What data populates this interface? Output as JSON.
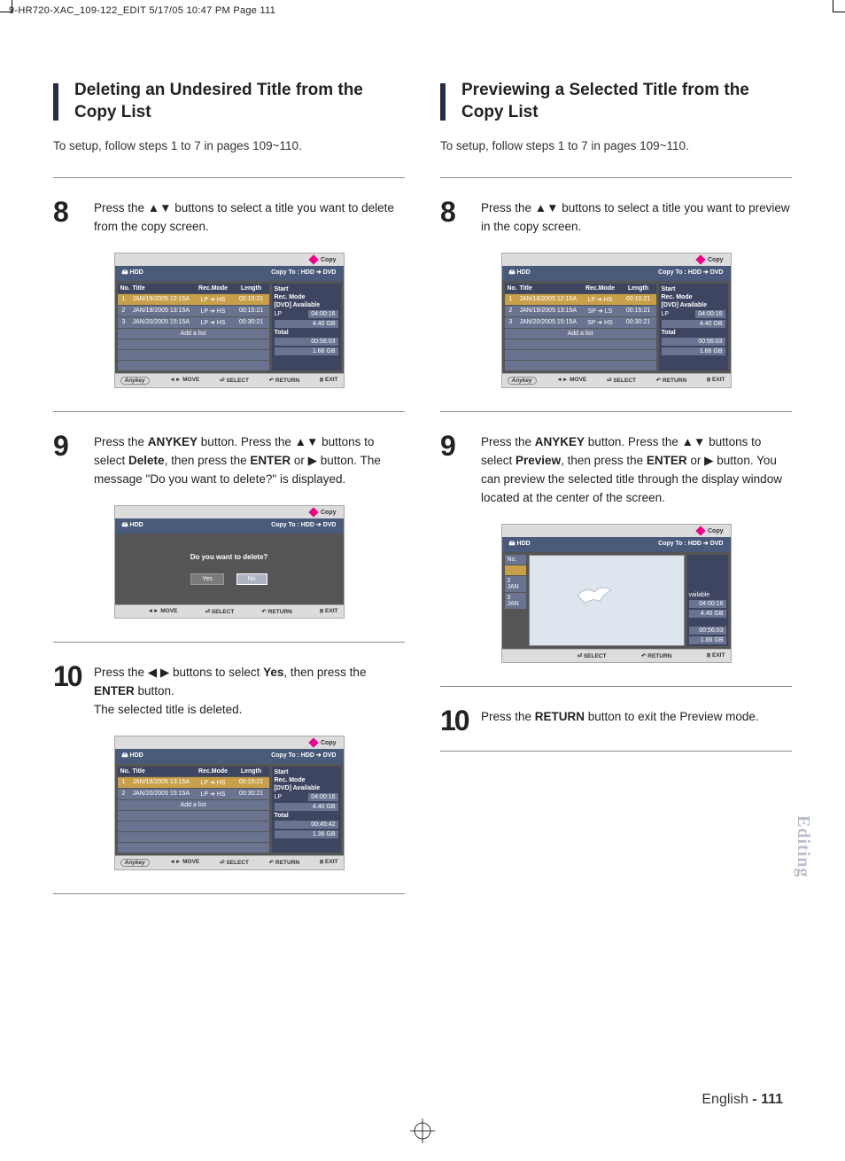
{
  "meta_header": "9-HR720-XAC_109-122_EDIT  5/17/05  10:47 PM  Page 111",
  "left": {
    "title": "Deleting an Undesired Title from the Copy List",
    "setup": "To setup, follow steps 1 to 7 in pages 109~110.",
    "step8_num": "8",
    "step8_txt": "Press the ▲▼ buttons to select a title you want to delete from the copy screen.",
    "step9_num": "9",
    "step9_txt_a": "Press the ",
    "step9_b1": "ANYKEY",
    "step9_txt_b": " button. Press the ▲▼ buttons to select ",
    "step9_b2": "Delete",
    "step9_txt_c": ", then press the ",
    "step9_b3": "ENTER",
    "step9_txt_d": " or ▶ button. The message \"Do you want to delete?\" is displayed.",
    "step10_num": "10",
    "step10_txt_a": "Press the ◀ ▶ buttons to select ",
    "step10_b1": "Yes",
    "step10_txt_b": ", then press the ",
    "step10_b2": "ENTER",
    "step10_txt_c": " button.",
    "step10_txt_d": "The selected title is deleted."
  },
  "right": {
    "title": "Previewing a Selected Title from the Copy List",
    "setup": "To setup, follow steps 1 to 7 in pages 109~110.",
    "step8_num": "8",
    "step8_txt": "Press the ▲▼ buttons to select a title you want to preview in the copy screen.",
    "step9_num": "9",
    "step9_txt_a": "Press the ",
    "step9_b1": "ANYKEY",
    "step9_txt_b": " button. Press the ▲▼ buttons to select ",
    "step9_b2": "Preview",
    "step9_txt_c": ", then press the ",
    "step9_b3": "ENTER",
    "step9_txt_d": " or ▶ button. You can preview the selected title through the display window located at the center of the screen.",
    "step10_num": "10",
    "step10_txt_a": "Press the ",
    "step10_b1": "RETURN",
    "step10_txt_b": " button to exit the Preview mode."
  },
  "osd": {
    "copy": "Copy",
    "src": "HDD",
    "dest": "Copy To : HDD ➔ DVD",
    "th_no": "No.",
    "th_title": "Title",
    "th_mode": "Rec.Mode",
    "th_len": "Length",
    "rows": [
      {
        "no": "1",
        "title": "JAN/19/2005 12:15A",
        "mode": "LP ➔ HS",
        "len": "00:10:21"
      },
      {
        "no": "2",
        "title": "JAN/19/2005 13:15A",
        "mode": "LP ➔ HS",
        "len": "00:15:21"
      },
      {
        "no": "3",
        "title": "JAN/20/2005 15:15A",
        "mode": "LP ➔ HS",
        "len": "00:30:21"
      }
    ],
    "rows_r": [
      {
        "no": "1",
        "title": "JAN/18/2005 12:15A",
        "mode": "LP ➔ HS",
        "len": "00:10:21"
      },
      {
        "no": "2",
        "title": "JAN/19/2005 13:15A",
        "mode": "SP ➔ LS",
        "len": "00:15:21"
      },
      {
        "no": "3",
        "title": "JAN/20/2005 15:15A",
        "mode": "SP ➔ HS",
        "len": "00:30:21"
      }
    ],
    "rows_after": [
      {
        "no": "1",
        "title": "JAN/19/2005 13:15A",
        "mode": "LP ➔ HS",
        "len": "00:15:21"
      },
      {
        "no": "2",
        "title": "JAN/20/2005 15:15A",
        "mode": "LP ➔ HS",
        "len": "00:30:21"
      }
    ],
    "add": "Add a list",
    "r_start": "Start",
    "r_recmode": "Rec. Mode",
    "r_avail": "[DVD] Available",
    "r_lp": "LP",
    "r_lp_v": "04:00:16",
    "r_gb": "4.40 GB",
    "r_total": "Total",
    "r_total_v": "00:56:03",
    "r_total_gb": "1.66 GB",
    "r_total_v2": "00:45:42",
    "r_total_gb2": "1.36 GB",
    "r_total_v3": "00:56:03",
    "r_total_gb3": "1.66 GB",
    "foot_anykey": "Anykey",
    "foot_move": "◄► MOVE",
    "foot_select": "SELECT",
    "foot_return": "RETURN",
    "foot_exit": "EXIT",
    "dlg_msg": "Do you want to delete?",
    "dlg_yes": "Yes",
    "dlg_no": "No",
    "pv_no": "No.",
    "pv_r2": "2   JAN",
    "pv_r3": "3   JAN",
    "pv_avail": "vailable",
    "pv_v1": "04:00:16",
    "pv_v2": "4.40 GB",
    "pv_v3": "00:56:03",
    "pv_v4": "1.66 GB"
  },
  "side_tab": "Editing",
  "footer_lang": "English ",
  "footer_page": "- 111"
}
